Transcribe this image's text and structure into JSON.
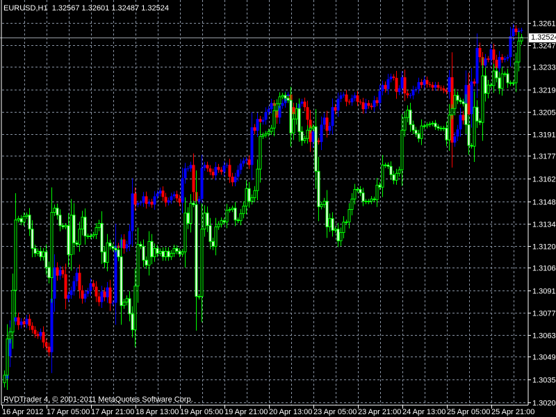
{
  "header": {
    "symbol_timeframe": "EURUSD,H1",
    "open": "1.32567",
    "high": "1.32601",
    "low": "1.32487",
    "close": "1.32524"
  },
  "footer": {
    "copyright": "RVDTrader 4, © 2001-2011 MetaQuotes Software Corp."
  },
  "current_price_label": "1.32524",
  "chart_data": {
    "type": "candlestick",
    "title": "EURUSD,H1",
    "grid": true,
    "ylim": [
      1.30205,
      1.32615
    ],
    "y_tick_labels": [
      "1.32615",
      "1.32475",
      "1.32335",
      "1.32190",
      "1.32050",
      "1.31910",
      "1.31770",
      "1.31625",
      "1.31480",
      "1.31340",
      "1.31200",
      "1.31060",
      "1.30915",
      "1.30775",
      "1.30635",
      "1.30495",
      "1.30350",
      "1.30205"
    ],
    "x_tick_labels": [
      "16 Apr 2012",
      "17 Apr 05:00",
      "17 Apr 21:00",
      "18 Apr 13:00",
      "19 Apr 05:00",
      "19 Apr 21:00",
      "20 Apr 13:00",
      "23 Apr 05:00",
      "23 Apr 21:00",
      "24 Apr 13:00",
      "25 Apr 05:00",
      "25 Apr 21:00"
    ],
    "bars_per_x_tick": 16,
    "current_price": 1.32524,
    "colors": {
      "background": "#000000",
      "grid": "#8a95a5",
      "price_candles": "#00ff00",
      "overlay_up": "#0000ff",
      "overlay_down": "#ff0000",
      "axis": "#ffffff"
    },
    "series": [
      {
        "kind": "price-candles",
        "color": "#00ff00",
        "first_open": 1.3033,
        "closes": [
          1.30378,
          1.30608,
          1.30652,
          1.30917,
          1.31364,
          1.31373,
          1.31351,
          1.31386,
          1.31395,
          1.31306,
          1.31183,
          1.31152,
          1.31165,
          1.3113,
          1.31161,
          1.31063,
          1.30997,
          1.31412,
          1.31439,
          1.31395,
          1.31328,
          1.3132,
          1.31328,
          1.31143,
          1.31395,
          1.31218,
          1.31209,
          1.31306,
          1.31382,
          1.31262,
          1.31258,
          1.31262,
          1.31271,
          1.31315,
          1.31342,
          1.31161,
          1.31094,
          1.31218,
          1.31196,
          1.31183,
          1.31174,
          1.3113,
          1.3082,
          1.30842,
          1.30864,
          1.30767,
          1.30666,
          1.30944,
          1.31209,
          1.31196,
          1.31108,
          1.31077,
          1.31227,
          1.3113,
          1.31183,
          1.31152,
          1.31165,
          1.3113,
          1.31165,
          1.3113,
          1.31152,
          1.31183,
          1.31165,
          1.31147,
          1.31161,
          1.31408,
          1.31342,
          1.3147,
          1.31461,
          1.30878,
          1.30878,
          1.31306,
          1.31408,
          1.31328,
          1.31227,
          1.31196,
          1.3132,
          1.31337,
          1.31359,
          1.31351,
          1.31426,
          1.3143,
          1.31439,
          1.31364,
          1.31359,
          1.31404,
          1.31452,
          1.31563,
          1.31483,
          1.31505,
          1.3155,
          1.31687,
          1.31894,
          1.31903,
          1.31912,
          1.31925,
          1.31947,
          1.32058,
          1.32102,
          1.32146,
          1.32155,
          1.32137,
          1.32124,
          1.31916,
          1.32005,
          1.32071,
          1.31925,
          1.31868,
          1.31881,
          1.31934,
          1.31947,
          1.31956,
          1.31673,
          1.31448,
          1.31461,
          1.31483,
          1.3132,
          1.31373,
          1.31298,
          1.31306,
          1.31231,
          1.31284,
          1.31351,
          1.31351,
          1.3143,
          1.31497,
          1.31558,
          1.31558,
          1.31536,
          1.31483,
          1.31483,
          1.31483,
          1.31497,
          1.31492,
          1.31585,
          1.31572,
          1.31713,
          1.31713,
          1.31704,
          1.31651,
          1.31616,
          1.3166,
          1.31682,
          1.31934,
          1.32014,
          1.32062,
          1.31969,
          1.31934,
          1.31912,
          1.31881,
          1.31961,
          1.31961,
          1.31969,
          1.31974,
          1.31978,
          1.31956,
          1.31947,
          1.31947,
          1.31947,
          1.31872,
          1.32031,
          1.32071,
          1.32155,
          1.32124,
          1.32115,
          1.32102,
          1.31969,
          1.31837,
          1.31832,
          1.3208,
          1.31992,
          1.31983,
          1.32279,
          1.32168,
          1.32221,
          1.32217,
          1.3231,
          1.32266,
          1.32199,
          1.32292,
          1.32292,
          1.32235,
          1.32235,
          1.32235,
          1.32367,
          1.325,
          1.32524
        ]
      },
      {
        "kind": "overlay-candles",
        "up_color": "#0000ff",
        "down_color": "#ff0000",
        "first_open": 1.3033,
        "closes": [
          1.30356,
          1.30498,
          1.30657,
          1.30719,
          1.30745,
          1.30696,
          1.30719,
          1.30701,
          1.30736,
          1.30692,
          1.30666,
          1.30639,
          1.30626,
          1.30652,
          1.30586,
          1.30559,
          1.30524,
          1.30864,
          1.31063,
          1.3101,
          1.31046,
          1.31019,
          1.30864,
          1.30887,
          1.30917,
          1.30975,
          1.31028,
          1.30917,
          1.30864,
          1.30895,
          1.30913,
          1.30962,
          1.3094,
          1.30878,
          1.30842,
          1.30909,
          1.30873,
          1.30935,
          1.30834,
          1.30838,
          1.312,
          1.31187,
          1.3124,
          1.31183,
          1.31209,
          1.31293,
          1.31532,
          1.31461,
          1.3147,
          1.31474,
          1.31514,
          1.31466,
          1.31479,
          1.31461,
          1.31514,
          1.31532,
          1.3155,
          1.3151,
          1.31474,
          1.31488,
          1.31514,
          1.31527,
          1.31501,
          1.31474,
          1.31629,
          1.31691,
          1.31691,
          1.31713,
          1.31541,
          1.31483,
          1.31497,
          1.31695,
          1.31713,
          1.31691,
          1.31669,
          1.31647,
          1.317,
          1.31682,
          1.31669,
          1.31709,
          1.31713,
          1.31638,
          1.31603,
          1.31638,
          1.31682,
          1.31722,
          1.3174,
          1.31748,
          1.31713,
          1.31952,
          1.3193,
          1.32005,
          1.31987,
          1.32,
          1.32049,
          1.32067,
          1.32106,
          1.32089,
          1.32014,
          1.32089,
          1.32106,
          1.32151,
          1.3216,
          1.3208,
          1.32036,
          1.32067,
          1.32102,
          1.32115,
          1.3208,
          1.32,
          1.31859,
          1.31925,
          1.31868,
          1.31859,
          1.31969,
          1.32014,
          1.3193,
          1.31961,
          1.3208,
          1.32058,
          1.32133,
          1.32155,
          1.3216,
          1.32115,
          1.32111,
          1.32137,
          1.32155,
          1.32115,
          1.32111,
          1.32067,
          1.32106,
          1.32089,
          1.3208,
          1.32124,
          1.32106,
          1.32182,
          1.32221,
          1.32195,
          1.32257,
          1.32274,
          1.32266,
          1.32177,
          1.32199,
          1.3227,
          1.32168,
          1.32155,
          1.32155,
          1.3219,
          1.32195,
          1.32239,
          1.32221,
          1.32252,
          1.32226,
          1.32221,
          1.32204,
          1.32221,
          1.32204,
          1.32199,
          1.32186,
          1.32177,
          1.3227,
          1.31855,
          1.31894,
          1.31939,
          1.32031,
          1.31996,
          1.32221,
          1.32036,
          1.32243,
          1.3223,
          1.32456,
          1.32398,
          1.32345,
          1.32389,
          1.32381,
          1.32447,
          1.32381,
          1.32327,
          1.32398,
          1.32381,
          1.32389,
          1.32398,
          1.32531,
          1.32579,
          1.32557,
          1.32566,
          1.3257
        ]
      }
    ]
  }
}
